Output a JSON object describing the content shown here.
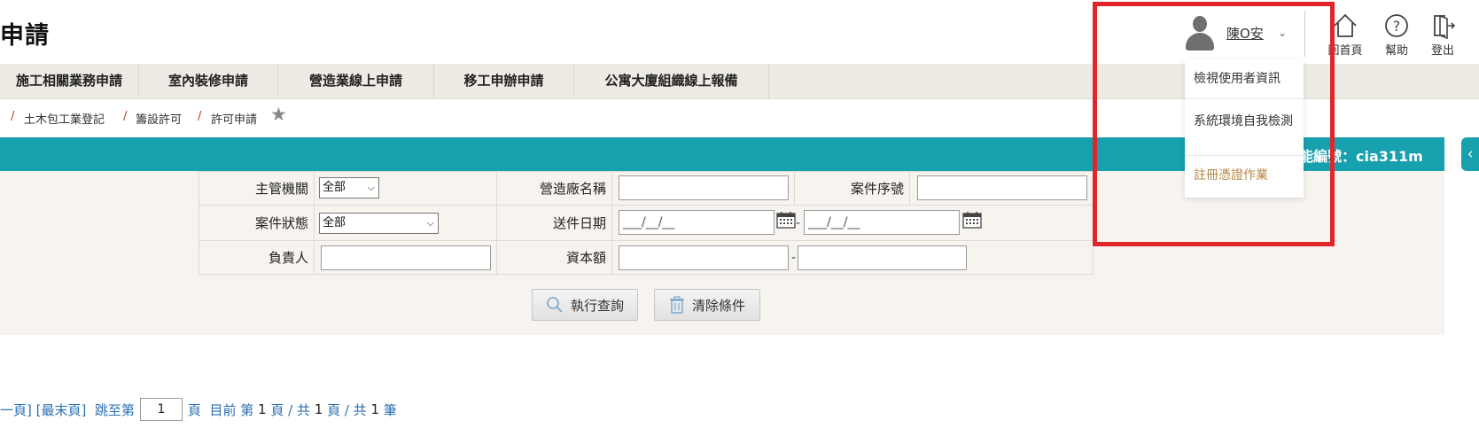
{
  "header": {
    "title": "申請",
    "user_name": "陳O安",
    "tools": [
      "回首頁",
      "幫助",
      "登出"
    ]
  },
  "nav": {
    "items": [
      "施工相關業務申請",
      "室內裝修申請",
      "營造業線上申請",
      "移工申辦申請",
      "公寓大廈組織線上報備"
    ]
  },
  "breadcrumb": [
    "土木包工業登記",
    "籌設許可",
    "許可申請"
  ],
  "function_bar": {
    "code_label": "能編號：cia311m"
  },
  "search": {
    "row1": {
      "label_agency": "主管機關",
      "agency_value": "全部",
      "label_company": "營造廠名稱",
      "company_value": "",
      "label_case_no": "案件序號",
      "case_no_value": ""
    },
    "row2": {
      "label_status": "案件狀態",
      "status_value": "全部",
      "label_date": "送件日期",
      "date_from_placeholder": "___/__/__",
      "date_to_placeholder": "___/__/__"
    },
    "row3": {
      "label_owner": "負責人",
      "owner_value": "",
      "label_capital": "資本額",
      "capital_from": "",
      "capital_to": ""
    },
    "buttons": {
      "query": "執行查詢",
      "clear": "清除條件"
    }
  },
  "pager": {
    "prev_partial": "一頁]",
    "last": "[最末頁]",
    "jump_prefix": "跳至第",
    "page_input": "1",
    "page_unit": "頁",
    "current_prefix": "目前 第",
    "current_page": "1",
    "total_pages_prefix": "頁 / 共",
    "total_pages": "1",
    "total_records_prefix": "頁 / 共",
    "total_records": "1",
    "records_unit": "筆"
  },
  "user_menu": {
    "items": [
      "檢視使用者資訊",
      "系統環境自我檢測",
      "註冊憑證作業"
    ]
  },
  "colors": {
    "teal": "#17a0ad",
    "nav_bg": "#eeeae4",
    "panel_bg": "#f7f4ef",
    "highlight_box": "#e1262b",
    "menu_highlight": "#b5884a",
    "link": "#2a6fb0"
  },
  "icons": [
    "user-avatar-icon",
    "chevron-down-icon",
    "home-icon",
    "help-icon",
    "logout-icon",
    "star-icon",
    "calendar-icon",
    "search-icon",
    "trash-icon",
    "chevron-left-icon"
  ]
}
